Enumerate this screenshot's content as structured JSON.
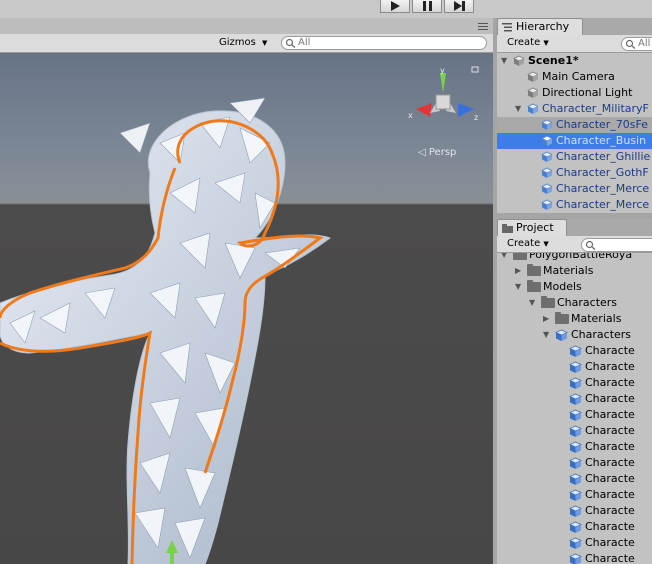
{
  "toolbar": {
    "play_icon": "play-icon",
    "pause_icon": "pause-icon",
    "step_icon": "step-icon"
  },
  "scene": {
    "gizmos_label": "Gizmos",
    "search_placeholder": "All",
    "persp_label": "Persp",
    "axis_y": "y",
    "axis_x": "x",
    "axis_z": "z",
    "colors": {
      "selection_outline": "#f07a1a",
      "sky": "#6f7c8d",
      "ground": "#4a4949"
    }
  },
  "hierarchy": {
    "tab_label": "Hierarchy",
    "create_label": "Create",
    "search_placeholder": "All",
    "items": [
      {
        "label": "Scene1*",
        "depth": 0,
        "expanded": true
      },
      {
        "label": "Main Camera",
        "depth": 1
      },
      {
        "label": "Directional Light",
        "depth": 1
      },
      {
        "label": "Character_MilitaryF",
        "depth": 1,
        "expanded": true,
        "prefab": true
      },
      {
        "label": "Character_70sFe",
        "depth": 2,
        "prefab": true
      },
      {
        "label": "Character_Busin",
        "depth": 2,
        "prefab": true,
        "selected": true
      },
      {
        "label": "Character_Ghillie",
        "depth": 2,
        "prefab": true
      },
      {
        "label": "Character_GothF",
        "depth": 2,
        "prefab": true
      },
      {
        "label": "Character_Merce",
        "depth": 2,
        "prefab": true
      },
      {
        "label": "Character_Merce",
        "depth": 2,
        "prefab": true
      }
    ]
  },
  "project": {
    "tab_label": "Project",
    "create_label": "Create",
    "items": [
      {
        "label": "PolygonBattleRoya",
        "type": "folder",
        "depth": 0
      },
      {
        "label": "Materials",
        "type": "folder",
        "depth": 1
      },
      {
        "label": "Models",
        "type": "folder",
        "depth": 1
      },
      {
        "label": "Characters",
        "type": "folder",
        "depth": 2
      },
      {
        "label": "Materials",
        "type": "folder",
        "depth": 3
      },
      {
        "label": "Characters",
        "type": "model",
        "depth": 3
      },
      {
        "label": "Characte",
        "type": "mesh",
        "depth": 4
      },
      {
        "label": "Characte",
        "type": "mesh",
        "depth": 4
      },
      {
        "label": "Characte",
        "type": "mesh",
        "depth": 4
      },
      {
        "label": "Characte",
        "type": "mesh",
        "depth": 4
      },
      {
        "label": "Characte",
        "type": "mesh",
        "depth": 4
      },
      {
        "label": "Characte",
        "type": "mesh",
        "depth": 4
      },
      {
        "label": "Characte",
        "type": "mesh",
        "depth": 4
      },
      {
        "label": "Characte",
        "type": "mesh",
        "depth": 4
      },
      {
        "label": "Characte",
        "type": "mesh",
        "depth": 4
      },
      {
        "label": "Characte",
        "type": "mesh",
        "depth": 4
      },
      {
        "label": "Characte",
        "type": "mesh",
        "depth": 4
      },
      {
        "label": "Characte",
        "type": "mesh",
        "depth": 4
      },
      {
        "label": "Characte",
        "type": "mesh",
        "depth": 4
      },
      {
        "label": "Characte",
        "type": "mesh",
        "depth": 4
      }
    ]
  }
}
